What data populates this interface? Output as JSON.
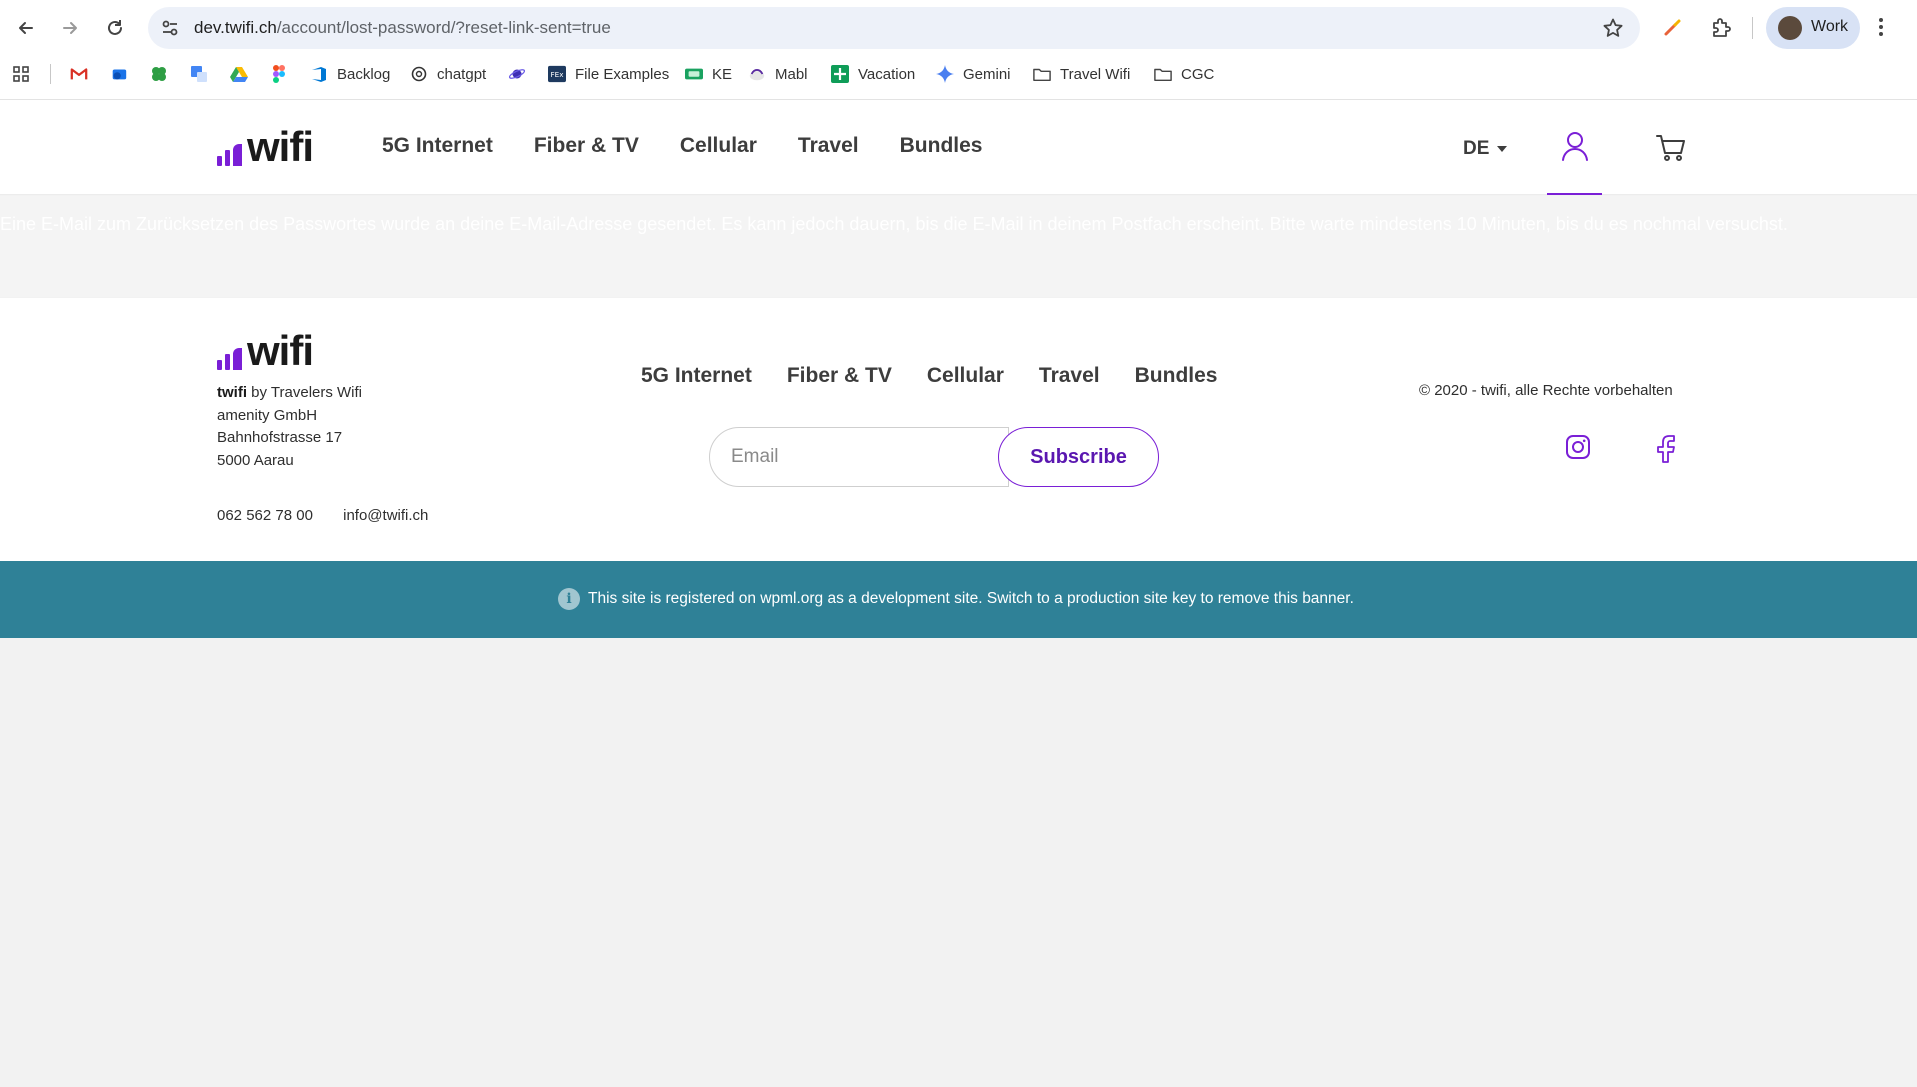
{
  "browser": {
    "url_host": "dev.twifi.ch",
    "url_path": "/account/lost-password/?reset-link-sent=true",
    "profile_label": "Work",
    "bookmarks": [
      {
        "label": "",
        "icon": "apps-grid-icon"
      },
      {
        "label": "",
        "icon": "gmail-icon"
      },
      {
        "label": "",
        "icon": "outlook-icon"
      },
      {
        "label": "",
        "icon": "clover-icon"
      },
      {
        "label": "",
        "icon": "translate-icon"
      },
      {
        "label": "",
        "icon": "drive-icon"
      },
      {
        "label": "",
        "icon": "figma-icon"
      },
      {
        "label": "Backlog",
        "icon": "azure-devops-icon"
      },
      {
        "label": "chatgpt",
        "icon": "chatgpt-icon"
      },
      {
        "label": "",
        "icon": "planet-icon"
      },
      {
        "label": "File Examples",
        "icon": "fex-icon"
      },
      {
        "label": "KE",
        "icon": "ke-icon"
      },
      {
        "label": "Mabl",
        "icon": "mabl-icon"
      },
      {
        "label": "Vacation",
        "icon": "sheets-icon"
      },
      {
        "label": "Gemini",
        "icon": "gemini-icon"
      },
      {
        "label": "Travel Wifi",
        "icon": "folder-icon"
      },
      {
        "label": "CGC",
        "icon": "folder-icon"
      }
    ]
  },
  "header": {
    "logo_text": "wifi",
    "nav": [
      "5G Internet",
      "Fiber & TV",
      "Cellular",
      "Travel",
      "Bundles"
    ],
    "language": "DE"
  },
  "notice": {
    "text": "Eine E-Mail zum Zurücksetzen des Passwortes wurde an deine E-Mail-Adresse gesendet. Es kann jedoch dauern, bis die E-Mail in deinem Postfach erscheint. Bitte warte mindestens 10 Minuten, bis du es nochmal versuchst."
  },
  "footer": {
    "logo_text": "wifi",
    "brand": "twifi",
    "brand_suffix": " by Travelers Wifi",
    "company": "amenity GmbH",
    "street": "Bahnhofstrasse 17",
    "city": "5000 Aarau",
    "phone": "062 562 78 00",
    "email": "info@twifi.ch",
    "nav": [
      "5G Internet",
      "Fiber & TV",
      "Cellular",
      "Travel",
      "Bundles"
    ],
    "email_placeholder": "Email",
    "subscribe_label": "Subscribe",
    "copyright": "© 2020 - twifi, alle Rechte vorbehalten"
  },
  "wpml_banner": {
    "text": "This site is registered on wpml.org as a development site. Switch to a production site key to remove this banner."
  },
  "colors": {
    "brand_purple": "#7a1fd6",
    "banner_teal": "#2f8197"
  }
}
